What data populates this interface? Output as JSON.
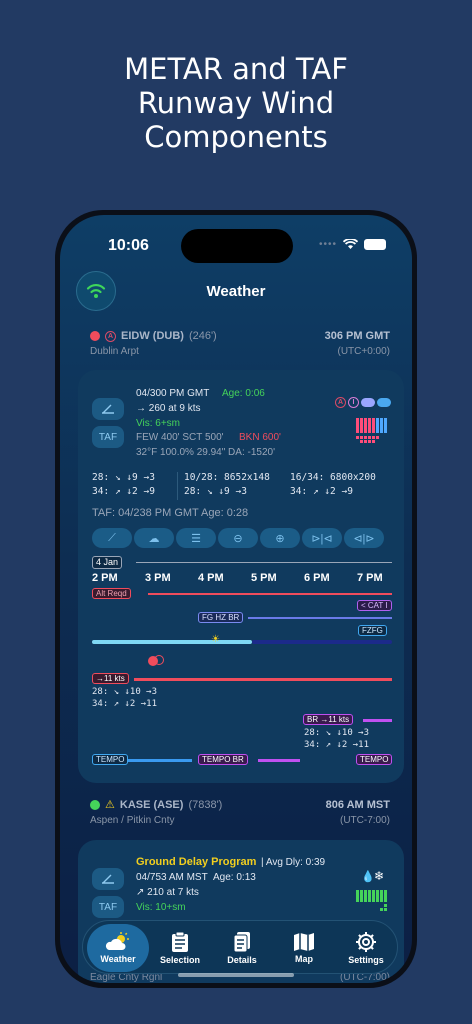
{
  "headline": [
    "METAR and TAF",
    "Runway Wind",
    "Components"
  ],
  "status": {
    "time": "10:06"
  },
  "nav": {
    "title": "Weather"
  },
  "stations": [
    {
      "id": "EIDW (DUB)",
      "elevation": "(246')",
      "name": "Dublin Arpt",
      "local_time": "306 PM GMT",
      "utc_offset": "(UTC+0:00)",
      "status_color": "#f04c5c",
      "metar": {
        "obs": "04/300 PM GMT",
        "age": "Age: 0:06",
        "wind": "260 at 9 kts",
        "vis": "Vis: 6+sm",
        "clouds": "FEW 400' SCT 500'",
        "ceiling": "BKN 600'",
        "temp_line": "32°F  100.0% 29.94\"  DA: -1520'"
      },
      "runways": [
        {
          "l1": "28:  ↘ ↓9 →3",
          "l2": "34:  ↗ ↓2 →9"
        },
        {
          "l1": "10/28:  8652x148",
          "l2": "28:  ↘ ↓9 →3"
        },
        {
          "l1": "16/34:  6800x200",
          "l2": "34:  ↗ ↓2 →9"
        }
      ],
      "taf": "TAF: 04/238 PM GMT  Age: 0:28",
      "date_tag": "4 Jan",
      "hours": [
        "2 PM",
        "3 PM",
        "4 PM",
        "5 PM",
        "6 PM",
        "7 PM"
      ],
      "labels": {
        "alt_reqd": "Alt Reqd",
        "fg": "FG HZ BR",
        "cat": "< CAT I",
        "fzfg": "FZFG",
        "wind1": "→11 kts",
        "w1a": "28:  ↘ ↓10 →3",
        "w1b": "34:  ↗ ↓2  →11",
        "br": "BR →11 kts",
        "w2a": "28:  ↘ ↓10 →3",
        "w2b": "34:  ↗ ↓2  →11",
        "tempo1": "TEMPO",
        "tempo2": "TEMPO BR",
        "tempo3": "TEMPO"
      }
    },
    {
      "id": "KASE (ASE)",
      "elevation": "(7838')",
      "name": "Aspen / Pitkin Cnty",
      "local_time": "806 AM MST",
      "utc_offset": "(UTC-7:00)",
      "status_color": "#45d35a",
      "program": "Ground Delay Program",
      "delay": "| Avg Dly: 0:39",
      "metar": {
        "obs": "04/753 AM MST",
        "age": "Age: 0:13",
        "wind": "210 at 7 kts",
        "vis": "Vis: 10+sm"
      }
    }
  ],
  "next_station": {
    "name": "Eagle Cnty Rgnl",
    "utc_offset": "(UTC-7:00)"
  },
  "tabs": [
    "Weather",
    "Selection",
    "Details",
    "Map",
    "Settings"
  ],
  "colors": {
    "accent": "#1e6aa0",
    "vfr": "#45d35a",
    "ifr": "#f04c5c",
    "warn": "#f2cf1f"
  }
}
